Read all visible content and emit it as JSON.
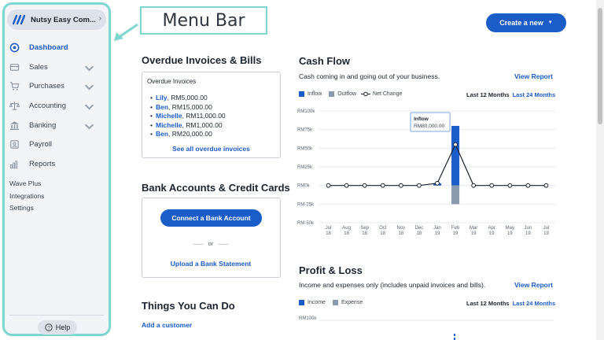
{
  "sidebar": {
    "business_name": "Nutsy Easy Com...",
    "nav": [
      {
        "label": "Dashboard",
        "icon": "dashboard-icon",
        "active": true,
        "chevron": false
      },
      {
        "label": "Sales",
        "icon": "sales-icon",
        "active": false,
        "chevron": true
      },
      {
        "label": "Purchases",
        "icon": "cart-icon",
        "active": false,
        "chevron": true
      },
      {
        "label": "Accounting",
        "icon": "scale-icon",
        "active": false,
        "chevron": true
      },
      {
        "label": "Banking",
        "icon": "bank-icon",
        "active": false,
        "chevron": true
      },
      {
        "label": "Payroll",
        "icon": "payroll-icon",
        "active": false,
        "chevron": false
      },
      {
        "label": "Reports",
        "icon": "reports-icon",
        "active": false,
        "chevron": false
      }
    ],
    "secondary": [
      "Wave Plus",
      "Integrations",
      "Settings"
    ],
    "help_label": "Help"
  },
  "annotation": {
    "label": "Menu Bar"
  },
  "header": {
    "create_label": "Create a new"
  },
  "overdue": {
    "title": "Overdue Invoices & Bills",
    "card_title": "Overdue Invoices",
    "items": [
      {
        "name": "Lily",
        "amount": ", RM5,000.00"
      },
      {
        "name": "Ben",
        "amount": ", RM15,000.00"
      },
      {
        "name": "Michelle",
        "amount": ", RM11,000.00"
      },
      {
        "name": "Michelle",
        "amount": ", RM1,000.00"
      },
      {
        "name": "Ben",
        "amount": ", RM20,000.00"
      }
    ],
    "link": "See all overdue invoices"
  },
  "bank": {
    "title": "Bank Accounts & Credit Cards",
    "connect_label": "Connect a Bank Account",
    "or_label": "or",
    "upload_label": "Upload a Bank Statement"
  },
  "things": {
    "title": "Things You Can Do",
    "add_customer": "Add a customer"
  },
  "cashflow": {
    "title": "Cash Flow",
    "subtitle": "Cash coming in and going out of your business.",
    "view_report": "View Report",
    "range_12": "Last 12 Months",
    "range_24": "Last 24 Months",
    "legend": {
      "inflow": "Inflow",
      "outflow": "Outflow",
      "net": "Net Change"
    },
    "tooltip": {
      "title": "Inflow",
      "value": "RM80,000.00"
    }
  },
  "profit_loss": {
    "title": "Profit & Loss",
    "subtitle": "Income and expenses only (includes unpaid invoices and bills).",
    "view_report": "View Report",
    "range_12": "Last 12 Months",
    "range_24": "Last 24 Months",
    "legend": {
      "income": "Income",
      "expense": "Expense"
    },
    "axis_top": "RM100k"
  },
  "colors": {
    "primary": "#1a5cc8",
    "outflow": "#8a9bb0",
    "highlight": "#7fd6cf"
  },
  "chart_data": {
    "type": "bar",
    "categories": [
      [
        "Jul",
        "18"
      ],
      [
        "Aug",
        "18"
      ],
      [
        "Sep",
        "18"
      ],
      [
        "Oct",
        "18"
      ],
      [
        "Nov",
        "18"
      ],
      [
        "Dec",
        "18"
      ],
      [
        "Jan",
        "19"
      ],
      [
        "Feb",
        "19"
      ],
      [
        "Mar",
        "19"
      ],
      [
        "Apr",
        "19"
      ],
      [
        "May",
        "19"
      ],
      [
        "Jun",
        "19"
      ],
      [
        "Jul",
        "19"
      ]
    ],
    "series": [
      {
        "name": "Inflow",
        "values": [
          0,
          0,
          0,
          0,
          0,
          0,
          3000,
          80000,
          0,
          0,
          0,
          0,
          0
        ]
      },
      {
        "name": "Outflow",
        "values": [
          0,
          0,
          0,
          0,
          0,
          0,
          0,
          -25000,
          0,
          0,
          0,
          0,
          0
        ]
      },
      {
        "name": "Net Change",
        "values": [
          0,
          0,
          0,
          0,
          0,
          0,
          3000,
          55000,
          0,
          0,
          0,
          0,
          0
        ]
      }
    ],
    "y_ticks": [
      "RM100k",
      "RM75k",
      "RM50k",
      "RM25k",
      "RM0k",
      "RM-25k",
      "RM-50k"
    ],
    "ylim": [
      -50000,
      100000
    ]
  }
}
